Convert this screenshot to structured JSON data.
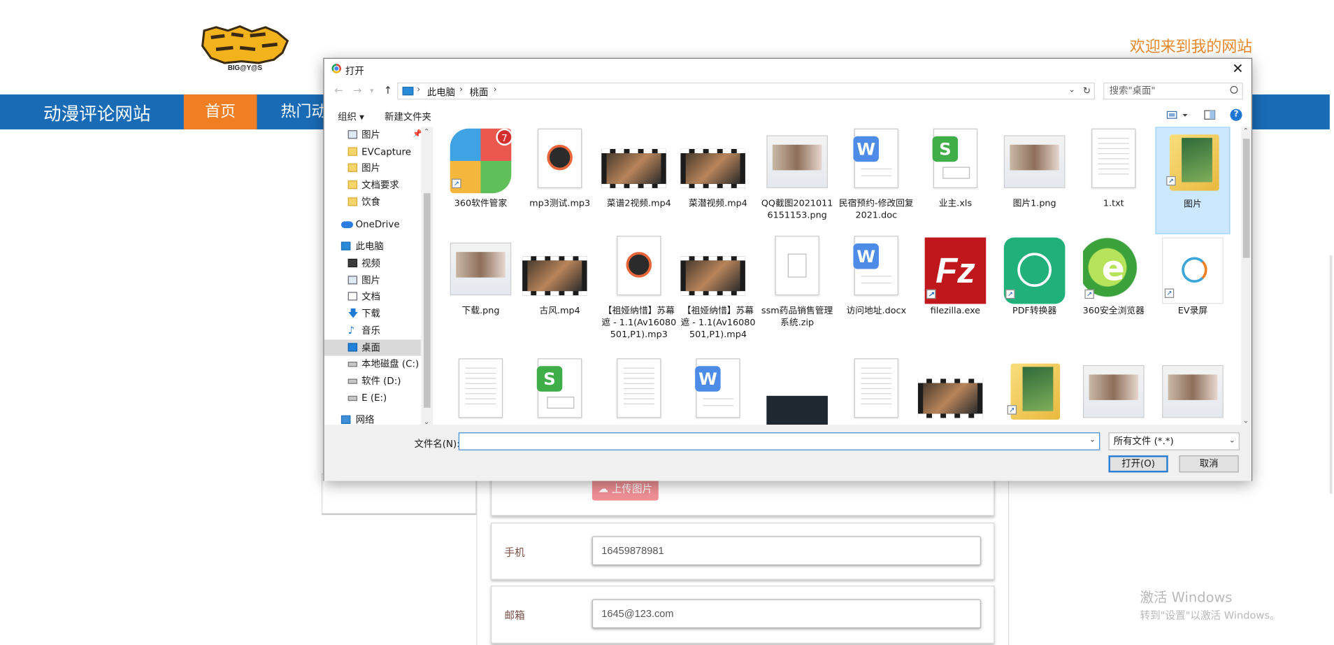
{
  "site": {
    "logo_text": "BIG@Y@S",
    "welcome": "欢迎来到我的网站",
    "brand": "动漫评论网站",
    "nav": [
      "首页",
      "热门动"
    ],
    "upload_button": "上传图片",
    "phone_label": "手机",
    "phone_value": "16459878981",
    "email_label": "邮箱",
    "email_value": "1645@123.com",
    "activate_line1": "激活 Windows",
    "activate_line2": "转到\"设置\"以激活 Windows。"
  },
  "dialog": {
    "title": "打开",
    "close": "✕",
    "breadcrumb": [
      "此电脑",
      "桃面"
    ],
    "search_placeholder": "搜索\"桌面\"",
    "organize": "组织 ▾",
    "new_folder": "新建文件夹",
    "nav_items": [
      {
        "label": "图片",
        "icon": "picture-icon"
      },
      {
        "label": "EVCapture",
        "icon": "folder-icon"
      },
      {
        "label": "图片",
        "icon": "folder-icon"
      },
      {
        "label": "文档要求",
        "icon": "folder-icon"
      },
      {
        "label": "饮食",
        "icon": "folder-icon"
      },
      {
        "label": "OneDrive",
        "icon": "onedrive-icon"
      },
      {
        "label": "此电脑",
        "icon": "pc-icon"
      },
      {
        "label": "视频",
        "icon": "video-icon"
      },
      {
        "label": "图片",
        "icon": "picture-icon"
      },
      {
        "label": "文档",
        "icon": "document-icon"
      },
      {
        "label": "下载",
        "icon": "download-icon"
      },
      {
        "label": "音乐",
        "icon": "music-icon"
      },
      {
        "label": "桌面",
        "icon": "desktop-icon"
      },
      {
        "label": "本地磁盘 (C:)",
        "icon": "drive-icon"
      },
      {
        "label": "软件 (D:)",
        "icon": "drive-icon"
      },
      {
        "label": "E (E:)",
        "icon": "drive-icon"
      },
      {
        "label": "网络",
        "icon": "network-icon"
      }
    ],
    "files": [
      {
        "name": "360软件管家",
        "kind": "app-360",
        "badge": "7"
      },
      {
        "name": "mp3测试.mp3",
        "kind": "mp3"
      },
      {
        "name": "菜谱2视频.mp4",
        "kind": "video"
      },
      {
        "name": "菜潜视频.mp4",
        "kind": "video"
      },
      {
        "name": "QQ截图20210116151153.png",
        "kind": "image"
      },
      {
        "name": "民宿预约-修改回复2021.doc",
        "kind": "word"
      },
      {
        "name": "业主.xls",
        "kind": "excel"
      },
      {
        "name": "图片1.png",
        "kind": "image"
      },
      {
        "name": "1.txt",
        "kind": "text"
      },
      {
        "name": "图片",
        "kind": "folder"
      },
      {
        "name": "下载.png",
        "kind": "image"
      },
      {
        "name": "古风.mp4",
        "kind": "video"
      },
      {
        "name": "【祖娅纳惜】苏幕遮 - 1.1(Av16080501,P1).mp3",
        "kind": "mp3"
      },
      {
        "name": "【祖娅纳惜】苏幕遮 - 1.1(Av16080501,P1).mp4",
        "kind": "video"
      },
      {
        "name": "ssm药品销售管理系统.zip",
        "kind": "zip"
      },
      {
        "name": "访问地址.docx",
        "kind": "word"
      },
      {
        "name": "filezilla.exe",
        "kind": "filezilla"
      },
      {
        "name": "PDF转换器",
        "kind": "pdfconv"
      },
      {
        "name": "360安全浏览器",
        "kind": "ie360"
      },
      {
        "name": "EV录屏",
        "kind": "ev"
      },
      {
        "name": "",
        "kind": "text"
      },
      {
        "name": "",
        "kind": "excel"
      },
      {
        "name": "",
        "kind": "text"
      },
      {
        "name": "",
        "kind": "word"
      },
      {
        "name": "",
        "kind": "dark"
      },
      {
        "name": "",
        "kind": "text"
      },
      {
        "name": "",
        "kind": "video"
      },
      {
        "name": "",
        "kind": "folder"
      },
      {
        "name": "",
        "kind": "image"
      },
      {
        "name": "",
        "kind": "image"
      }
    ],
    "filename_label": "文件名(N):",
    "filename_value": "",
    "filter": "所有文件 (*.*)",
    "open_button": "打开(O)",
    "cancel_button": "取消"
  }
}
